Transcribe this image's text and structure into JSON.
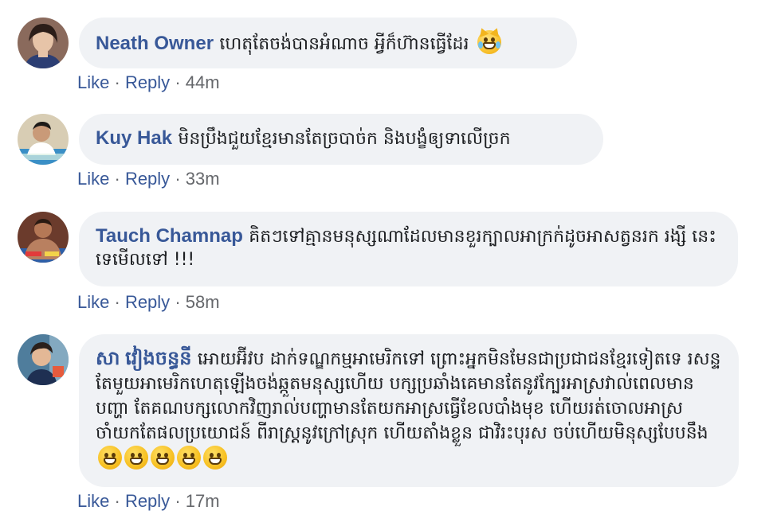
{
  "comments": [
    {
      "author": "Neath Owner",
      "text": "ហេតុតែចង់បានអំណាច អ្វីក៏ហ៊ានធ្វើដែរ",
      "emoji": "crying-laughing-cat-emoji",
      "like_label": "Like",
      "reply_label": "Reply",
      "separator": "·",
      "time": "44m",
      "avatar_color": "#8a6a5c"
    },
    {
      "author": "Kuy Hak",
      "text": "មិនប្រឹងជួយខ្មែរមានតែច្របាច់ក និងបង្ខំឲ្យទាលើច្រក",
      "like_label": "Like",
      "reply_label": "Reply",
      "separator": "·",
      "time": "33m",
      "avatar_color": "#c9b79a"
    },
    {
      "author": "Tauch Chamnap",
      "text": "គិតៗទៅគ្មានមនុស្សណាដែលមានខួរក្បាលអាក្រក់ដូចអាសត្វនរក រង្សី នេះទេមើលទៅ !!!",
      "like_label": "Like",
      "reply_label": "Reply",
      "separator": "·",
      "time": "58m",
      "avatar_color": "#7a4a3a"
    },
    {
      "author": "សា វៀងចន្ធនី",
      "text": "អោយអ៊ីវប ដាក់ទណ្ឌកម្មអាមេរិកទៅ ព្រោះអ្នកមិនមែនជាប្រជាជនខ្មែរទៀតទេ រសន្ទតែមួយអាមេរិកហេតុឡើងចង់ឆ្កួតមនុស្សហើយ បក្សប្រឆាំងគេមានតែនូវក្បែរអាស្រវាល់ពេលមានបញ្ហា តែគណបក្សលោកវិញរាល់បញ្ហាមានតែយកអាស្រធ្វើខែលបាំងមុខ ហើយរត់ចោលអាស្រ ចាំយកតែផលប្រយោជន៍ ពីរាស្រ្តនូវក្រៅស្រុក ហើយតាំងខ្លួន ជាវិរះបុរស ចប់ហើយមិនុស្សបែបនឹង",
      "emojis": [
        "grinning-emoji",
        "grinning-emoji",
        "grinning-emoji",
        "grinning-emoji",
        "grinning-emoji"
      ],
      "like_label": "Like",
      "reply_label": "Reply",
      "separator": "·",
      "time": "17m",
      "avatar_color": "#5d7f9a"
    }
  ],
  "colors": {
    "name": "#385898",
    "bubble": "#f0f2f5",
    "meta": "#65676b"
  }
}
